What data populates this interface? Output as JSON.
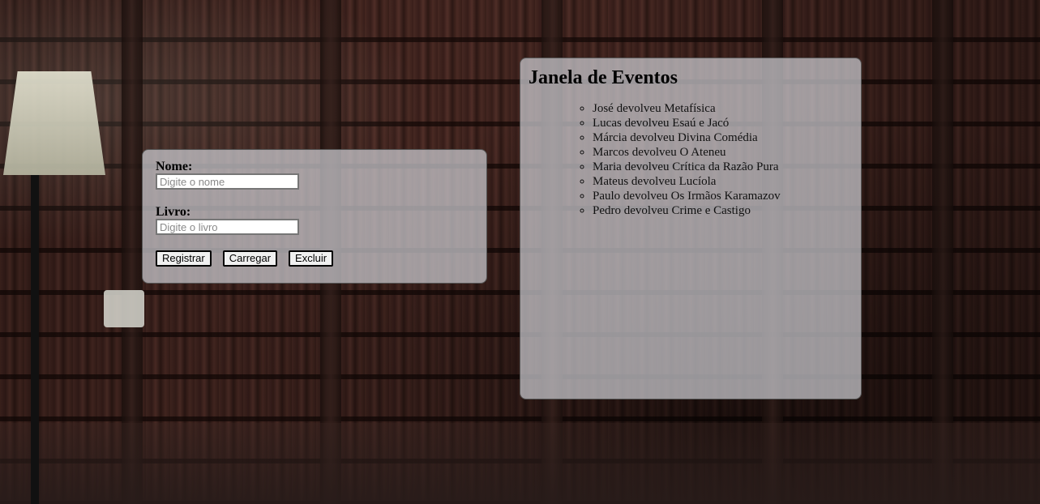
{
  "form": {
    "name_label": "Nome:",
    "name_placeholder": "Digite o nome",
    "book_label": "Livro:",
    "book_placeholder": "Digite o livro",
    "buttons": {
      "register": "Registrar",
      "load": "Carregar",
      "delete": "Excluir"
    }
  },
  "events": {
    "title": "Janela de Eventos",
    "items": [
      "José devolveu Metafísica",
      "Lucas devolveu Esaú e Jacó",
      "Márcia devolveu Divina Comédia",
      "Marcos devolveu O Ateneu",
      "Maria devolveu Crítica da Razão Pura",
      "Mateus devolveu Lucíola",
      "Paulo devolveu Os Irmãos Karamazov",
      "Pedro devolveu Crime e Castigo"
    ]
  }
}
